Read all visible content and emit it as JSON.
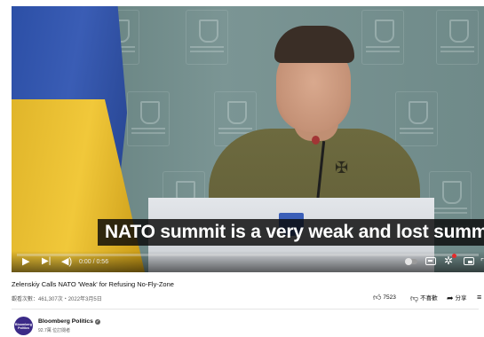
{
  "video": {
    "caption": "NATO summit is a very weak and lost summit.",
    "time": "0:00 / 0:56",
    "progress_fraction": 0.0,
    "podium_emblem": "ukraine-trident-icon",
    "background_text": [
      "OФIC",
      "ПРЕЗИДЕНТА",
      "УКРАЇНИ"
    ]
  },
  "controls": {
    "play_icon": "play-icon",
    "next_icon": "next-icon",
    "volume_icon": "volume-icon",
    "autoplay_icon": "autoplay-toggle-icon",
    "subtitles_icon": "subtitles-icon",
    "settings_icon": "gear-icon",
    "miniplayer_icon": "miniplayer-icon"
  },
  "info": {
    "title": "Zelenskiy Calls NATO 'Weak' for Refusing No-Fly-Zone",
    "meta": "觀看次數：461,307次・2022年3月5日",
    "likes": "7523",
    "dislike_label": "不喜歡",
    "share_label": "分享"
  },
  "channel": {
    "name": "Bloomberg Politics",
    "avatar_text": "Bloomberg Politics",
    "subscribers": "92.7萬 位訂閱者"
  },
  "colors": {
    "caption_bg": "#080808",
    "flag_blue": "#2c4fa6",
    "flag_yellow": "#f1c83a",
    "avatar": "#3b2a87"
  }
}
